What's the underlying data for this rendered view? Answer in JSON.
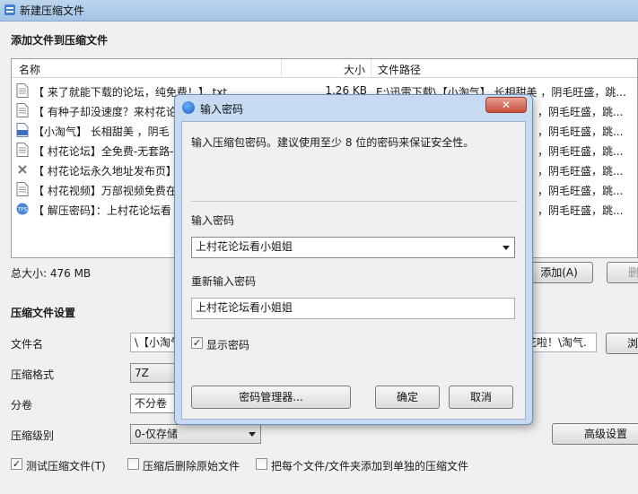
{
  "window": {
    "title": "新建压缩文件"
  },
  "section_add": {
    "heading": "添加文件到压缩文件"
  },
  "file_list": {
    "columns": [
      "名称",
      "大小",
      "文件路径"
    ],
    "rows": [
      {
        "name": "【 来了就能下载的论坛，纯免费！】.txt",
        "size": "1.26 KB",
        "path": "E:\\迅雷下载\\【小淘气】 长相甜美 ，阴毛旺盛，跳...",
        "icon": "text-file-icon"
      },
      {
        "name": "【 有种子却没速度？来村花论",
        "size": "",
        "path": "",
        "icon": "text-file-icon"
      },
      {
        "name": "【小淘气】 长相甜美 ，阴毛",
        "size": "",
        "path": "",
        "icon": "mp4-file-icon"
      },
      {
        "name": "【 村花论坛】全免费-无套路-",
        "size": "",
        "path": "",
        "icon": "text-file-icon"
      },
      {
        "name": "【 村花论坛永久地址发布页】",
        "size": "",
        "path": "",
        "icon": "url-file-icon"
      },
      {
        "name": "【 村花视频】万部视频免费在",
        "size": "",
        "path": "",
        "icon": "text-file-icon"
      },
      {
        "name": "【 解压密码】：上村花论坛看",
        "size": "",
        "path": "",
        "icon": "tps-file-icon"
      }
    ],
    "path_tail": "，阴毛旺盛，跳..."
  },
  "total_size": "总大小: 476 MB",
  "buttons": {
    "add": "添加(A)",
    "delete": "删",
    "browse": "浏",
    "advanced": "高级设置"
  },
  "settings": {
    "heading": "压缩文件设置",
    "filename_label": "文件名",
    "filename_value_left": "\\【小淘气",
    "filename_value_right": "花啦！\\淘气.",
    "format_label": "压缩格式",
    "format_value": "7Z",
    "split_label": "分卷",
    "split_value": "不分卷",
    "level_label": "压缩级别",
    "level_value": "0-仅存储",
    "test_label": "测试压缩文件(T)",
    "delete_after_label": "压缩后删除原始文件",
    "each_separate_label": "把每个文件/文件夹添加到单独的压缩文件"
  },
  "dialog": {
    "title": "输入密码",
    "close": "✕",
    "hint": "输入压缩包密码。建议使用至少 8 位的密码来保证安全性。",
    "password_label": "输入密码",
    "password_value": "上村花论坛看小姐姐",
    "confirm_label": "重新输入密码",
    "confirm_value": "上村花论坛看小姐姐",
    "show_password_label": "显示密码",
    "manager_button": "密码管理器...",
    "ok_button": "确定",
    "cancel_button": "取消"
  }
}
